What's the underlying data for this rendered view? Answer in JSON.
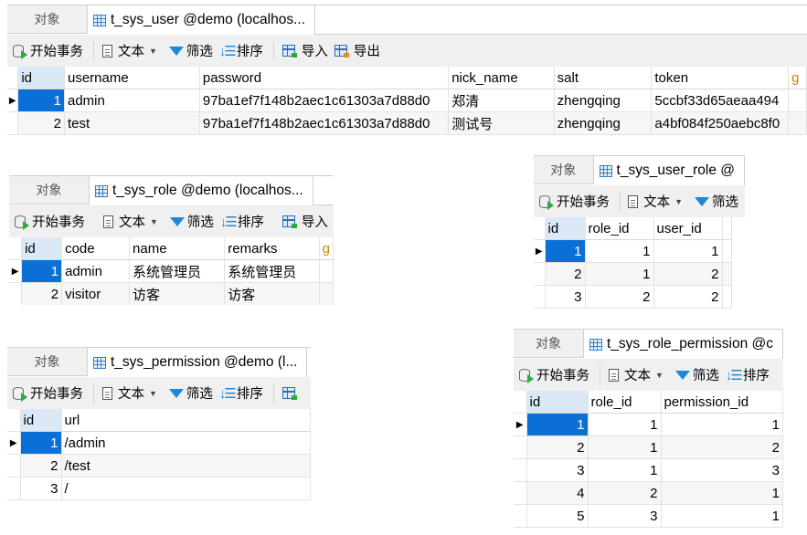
{
  "common": {
    "objects_tab": "对象",
    "toolbar": {
      "begin_transaction": "开始事务",
      "text": "文本",
      "filter": "筛选",
      "sort": "排序",
      "import": "导入",
      "export": "导出"
    },
    "row_indicator": "▶"
  },
  "panels": {
    "user": {
      "tab_title": "t_sys_user @demo (localhos...",
      "columns": [
        "id",
        "username",
        "password",
        "nick_name",
        "salt",
        "token",
        "g"
      ],
      "rows": [
        [
          "1",
          "admin",
          "97ba1ef7f148b2aec1c61303a7d88d0",
          "郑清",
          "zhengqing",
          "5ccbf33d65aeaa494"
        ],
        [
          "2",
          "test",
          "97ba1ef7f148b2aec1c61303a7d88d0",
          "测试号",
          "zhengqing",
          "a4bf084f250aebc8f0"
        ]
      ]
    },
    "role": {
      "tab_title": "t_sys_role @demo (localhos...",
      "columns": [
        "id",
        "code",
        "name",
        "remarks",
        "g"
      ],
      "rows": [
        [
          "1",
          "admin",
          "系统管理员",
          "系统管理员"
        ],
        [
          "2",
          "visitor",
          "访客",
          "访客"
        ]
      ]
    },
    "user_role": {
      "tab_title": "t_sys_user_role @",
      "columns": [
        "id",
        "role_id",
        "user_id"
      ],
      "rows": [
        [
          "1",
          "1",
          "1"
        ],
        [
          "2",
          "1",
          "2"
        ],
        [
          "3",
          "2",
          "2"
        ]
      ]
    },
    "permission": {
      "tab_title": "t_sys_permission @demo (l...",
      "columns": [
        "id",
        "url"
      ],
      "rows": [
        [
          "1",
          "/admin"
        ],
        [
          "2",
          "/test"
        ],
        [
          "3",
          "/"
        ]
      ]
    },
    "role_permission": {
      "tab_title": "t_sys_role_permission @c",
      "columns": [
        "id",
        "role_id",
        "permission_id"
      ],
      "rows": [
        [
          "1",
          "1",
          "1"
        ],
        [
          "2",
          "1",
          "2"
        ],
        [
          "3",
          "1",
          "3"
        ],
        [
          "4",
          "2",
          "1"
        ],
        [
          "5",
          "3",
          "1"
        ]
      ]
    }
  }
}
